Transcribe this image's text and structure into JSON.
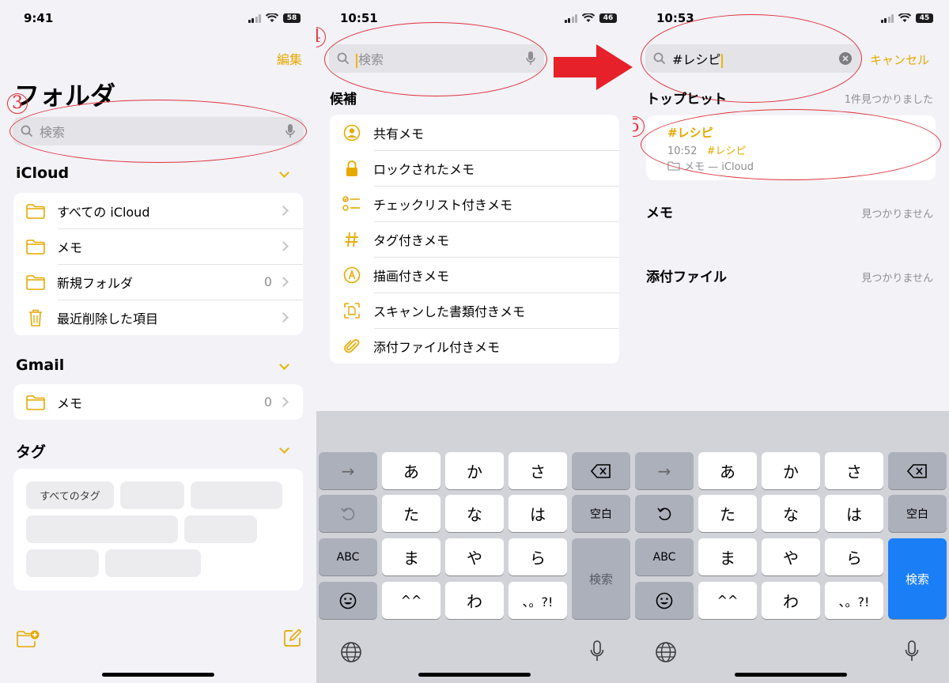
{
  "colors": {
    "accent": "#E5A900",
    "annotation": "#E0303A",
    "keyboard_search": "#1A7EF7"
  },
  "panel1": {
    "time": "9:41",
    "battery": "58",
    "edit": "編集",
    "title": "フォルダ",
    "annotation": "3",
    "search_placeholder": "検索",
    "icloud": {
      "header": "iCloud",
      "items": [
        {
          "label": "すべての iCloud",
          "count": "",
          "icon": "folder-icon"
        },
        {
          "label": "メモ",
          "count": "",
          "icon": "folder-icon"
        },
        {
          "label": "新規フォルダ",
          "count": "0",
          "icon": "folder-icon"
        },
        {
          "label": "最近削除した項目",
          "count": "",
          "icon": "trash-icon"
        }
      ]
    },
    "gmail": {
      "header": "Gmail",
      "items": [
        {
          "label": "メモ",
          "count": "0",
          "icon": "folder-icon"
        }
      ]
    },
    "tags": {
      "header": "タグ",
      "all_tags": "すべてのタグ"
    }
  },
  "panel2": {
    "time": "10:51",
    "battery": "46",
    "annotation": "4",
    "search_placeholder": "検索",
    "suggest_header": "候補",
    "suggestions": [
      {
        "label": "共有メモ",
        "icon": "person-circle-icon"
      },
      {
        "label": "ロックされたメモ",
        "icon": "lock-icon"
      },
      {
        "label": "チェックリスト付きメモ",
        "icon": "checklist-icon"
      },
      {
        "label": "タグ付きメモ",
        "icon": "hashtag-icon"
      },
      {
        "label": "描画付きメモ",
        "icon": "pen-circle-icon"
      },
      {
        "label": "スキャンした書類付きメモ",
        "icon": "doc-scan-icon"
      },
      {
        "label": "添付ファイル付きメモ",
        "icon": "paperclip-icon"
      }
    ]
  },
  "panel3": {
    "time": "10:53",
    "battery": "45",
    "annotation": "5",
    "search_value": "#レシピ",
    "cancel": "キャンセル",
    "top_hit_header": "トップヒット",
    "top_hit_count": "1件見つかりました",
    "result": {
      "title": "#レシピ",
      "time": "10:52",
      "tag": "#レシピ",
      "folder": "メモ — iCloud"
    },
    "memo_header": "メモ",
    "memo_status": "見つかりません",
    "attach_header": "添付ファイル",
    "attach_status": "見つかりません"
  },
  "keyboard": {
    "arrow": "→",
    "row1": [
      "あ",
      "か",
      "さ"
    ],
    "row2": [
      "た",
      "な",
      "は"
    ],
    "row3": [
      "ま",
      "や",
      "ら"
    ],
    "row4": [
      "^^",
      "わ",
      "、。?!"
    ],
    "space": "空白",
    "abc": "ABC",
    "search": "検索"
  }
}
